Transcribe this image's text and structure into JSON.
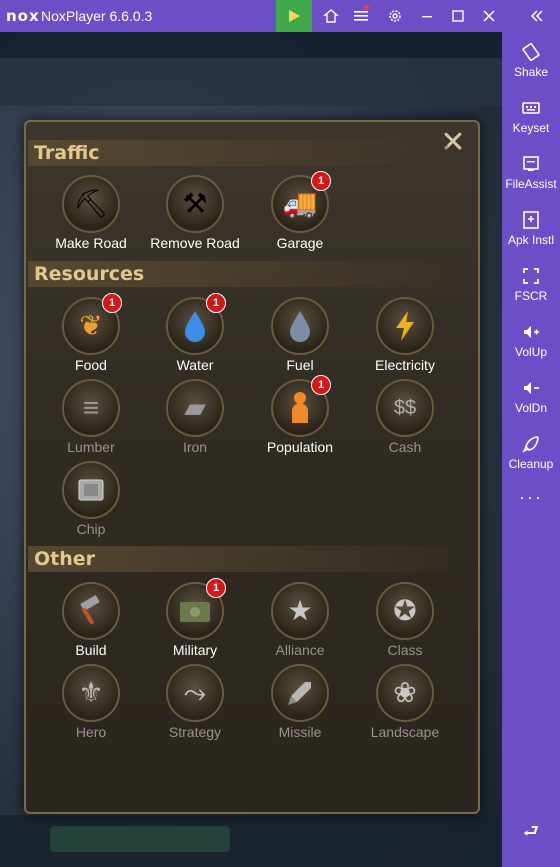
{
  "window": {
    "logo": "nox",
    "title": "NoxPlayer 6.6.0.3",
    "buttons": [
      "play-store",
      "home",
      "menu",
      "settings",
      "minimize",
      "maximize",
      "close",
      "collapse"
    ]
  },
  "sidebar": {
    "items": [
      {
        "label": "Shake",
        "icon": "shake-icon"
      },
      {
        "label": "Keyset",
        "icon": "keyboard-icon"
      },
      {
        "label": "FileAssist",
        "icon": "file-icon"
      },
      {
        "label": "Apk Instl",
        "icon": "apk-icon"
      },
      {
        "label": "FSCR",
        "icon": "fullscreen-icon"
      },
      {
        "label": "VolUp",
        "icon": "volume-up-icon"
      },
      {
        "label": "VolDn",
        "icon": "volume-down-icon"
      },
      {
        "label": "Cleanup",
        "icon": "rocket-icon"
      }
    ],
    "more": "···",
    "back": "⮐"
  },
  "panel": {
    "close": "✕",
    "sections": [
      {
        "title": "Traffic",
        "items": [
          {
            "label": "Make Road",
            "icon": "road-pickaxe-icon",
            "badge": "",
            "dim": false
          },
          {
            "label": "Remove Road",
            "icon": "road-shovel-icon",
            "badge": "",
            "dim": false
          },
          {
            "label": "Garage",
            "icon": "truck-icon",
            "badge": "1",
            "dim": false
          }
        ]
      },
      {
        "title": "Resources",
        "items": [
          {
            "label": "Food",
            "icon": "wheat-icon",
            "badge": "1",
            "dim": false
          },
          {
            "label": "Water",
            "icon": "water-drop-icon",
            "badge": "1",
            "dim": false
          },
          {
            "label": "Fuel",
            "icon": "fuel-drop-icon",
            "badge": "",
            "dim": false
          },
          {
            "label": "Electricity",
            "icon": "lightning-icon",
            "badge": "",
            "dim": false
          },
          {
            "label": "Lumber",
            "icon": "logs-icon",
            "badge": "",
            "dim": true
          },
          {
            "label": "Iron",
            "icon": "iron-bars-icon",
            "badge": "",
            "dim": true
          },
          {
            "label": "Population",
            "icon": "person-icon",
            "badge": "1",
            "dim": false
          },
          {
            "label": "Cash",
            "icon": "cash-icon",
            "badge": "",
            "dim": true
          },
          {
            "label": "Chip",
            "icon": "chip-icon",
            "badge": "",
            "dim": true
          }
        ]
      },
      {
        "title": "Other",
        "items": [
          {
            "label": "Build",
            "icon": "hammer-icon",
            "badge": "",
            "dim": false
          },
          {
            "label": "Military",
            "icon": "military-crate-icon",
            "badge": "1",
            "dim": false
          },
          {
            "label": "Alliance",
            "icon": "alliance-star-icon",
            "badge": "",
            "dim": true
          },
          {
            "label": "Class",
            "icon": "class-star-icon",
            "badge": "",
            "dim": true
          },
          {
            "label": "Hero",
            "icon": "hero-wings-icon",
            "badge": "",
            "dim": true
          },
          {
            "label": "Strategy",
            "icon": "strategy-arrows-icon",
            "badge": "",
            "dim": true
          },
          {
            "label": "Missile",
            "icon": "missile-icon",
            "badge": "",
            "dim": true
          },
          {
            "label": "Landscape",
            "icon": "landscape-bush-icon",
            "badge": "",
            "dim": true
          }
        ]
      }
    ]
  },
  "colors": {
    "chrome": "#6c4fc7",
    "play_button": "#3ea84a",
    "section_title": "#e6c88c",
    "badge": "#d41818"
  }
}
